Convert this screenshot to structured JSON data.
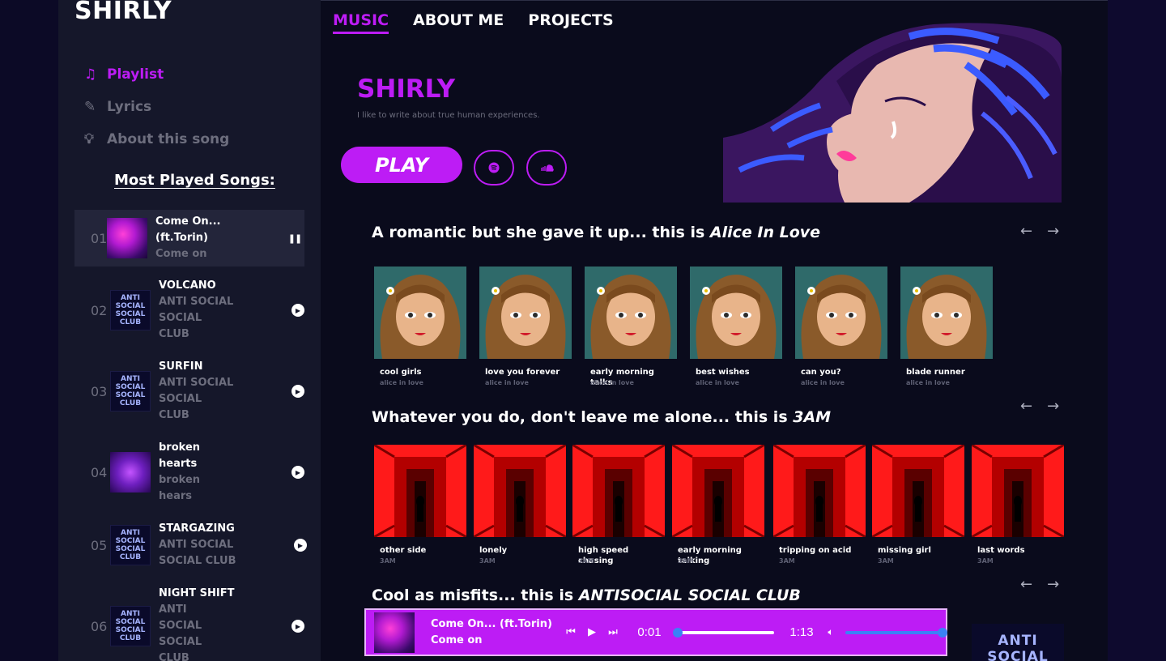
{
  "brand": "SHIRLY",
  "sidebar": {
    "nav": [
      {
        "label": "Playlist",
        "icon": "music-note-icon"
      },
      {
        "label": "Lyrics",
        "icon": "pencil-icon"
      },
      {
        "label": "About this song",
        "icon": "lightbulb-icon"
      }
    ],
    "section_title": "Most Played Songs:",
    "songs": [
      {
        "num": "01",
        "title_l1": "Come On...",
        "title_l2": "(ft.Torin)",
        "sub_l1": "Come on",
        "sub_l2": "",
        "sub_l3": "",
        "state": "playing"
      },
      {
        "num": "02",
        "title_l1": "VOLCANO",
        "title_l2": "",
        "sub_l1": "ANTI SOCIAL",
        "sub_l2": "SOCIAL",
        "sub_l3": "CLUB",
        "state": "paused"
      },
      {
        "num": "03",
        "title_l1": "SURFIN",
        "title_l2": "",
        "sub_l1": "ANTI SOCIAL",
        "sub_l2": "SOCIAL",
        "sub_l3": "CLUB",
        "state": "paused"
      },
      {
        "num": "04",
        "title_l1": "broken",
        "title_l2": "hearts",
        "sub_l1": "broken",
        "sub_l2": "hears",
        "sub_l3": "",
        "state": "paused"
      },
      {
        "num": "05",
        "title_l1": "STARGAZING",
        "title_l2": "",
        "sub_l1": "ANTI SOCIAL",
        "sub_l2": "SOCIAL CLUB",
        "sub_l3": "",
        "state": "paused"
      },
      {
        "num": "06",
        "title_l1": "NIGHT SHIFT",
        "title_l2": "",
        "sub_l1": "ANTI",
        "sub_l2": "SOCIAL",
        "sub_l3": "SOCIAL",
        "sub_l4": "CLUB",
        "state": "paused"
      }
    ],
    "asc_thumb_text": "ANTI SOCIAL SOCIAL CLUB"
  },
  "topnav": [
    "MUSIC",
    "ABOUT ME",
    "PROJECTS"
  ],
  "hero": {
    "title": "SHIRLY",
    "subtitle": "I like to write about true human experiences.",
    "play_label": "PLAY",
    "icons": [
      "spotify-icon",
      "soundcloud-icon"
    ]
  },
  "rows": [
    {
      "prefix": "A romantic but she gave it up... this is ",
      "album": "Alice In Love",
      "cards": [
        {
          "title": "cool girls",
          "sub": "alice in love"
        },
        {
          "title": "love you forever",
          "sub": "alice in love"
        },
        {
          "title": "early morning talks",
          "sub": "alice in love"
        },
        {
          "title": "best wishes",
          "sub": "alice in love"
        },
        {
          "title": "can you?",
          "sub": "alice in love"
        },
        {
          "title": "blade runner",
          "sub": "alice in love"
        }
      ]
    },
    {
      "prefix": "Whatever you do, don't leave me alone... this is ",
      "album": "3AM",
      "cards": [
        {
          "title": "other side",
          "sub": "3AM"
        },
        {
          "title": "lonely",
          "sub": "3AM"
        },
        {
          "title": "high speed chasing",
          "sub": "3AM"
        },
        {
          "title": "early morning talking",
          "sub": "3AM"
        },
        {
          "title": "tripping on acid",
          "sub": "3AM"
        },
        {
          "title": "missing girl",
          "sub": "3AM"
        },
        {
          "title": "last words",
          "sub": "3AM"
        }
      ]
    },
    {
      "prefix": "Cool as misfits... this is ",
      "album": "ANTISOCIAL SOCIAL CLUB"
    }
  ],
  "arrows": {
    "prev": "←",
    "next": "→"
  },
  "player": {
    "title": "Come On... (ft.Torin)",
    "sub": "Come on",
    "time_current": "0:01",
    "time_total": "1:13",
    "progress_fraction": 0.01,
    "volume_fraction": 1.0
  },
  "colors": {
    "accent": "#bd1cf5",
    "background": "#0a0b1c",
    "sidebar": "#15172a",
    "slider": "#3b82f6"
  }
}
